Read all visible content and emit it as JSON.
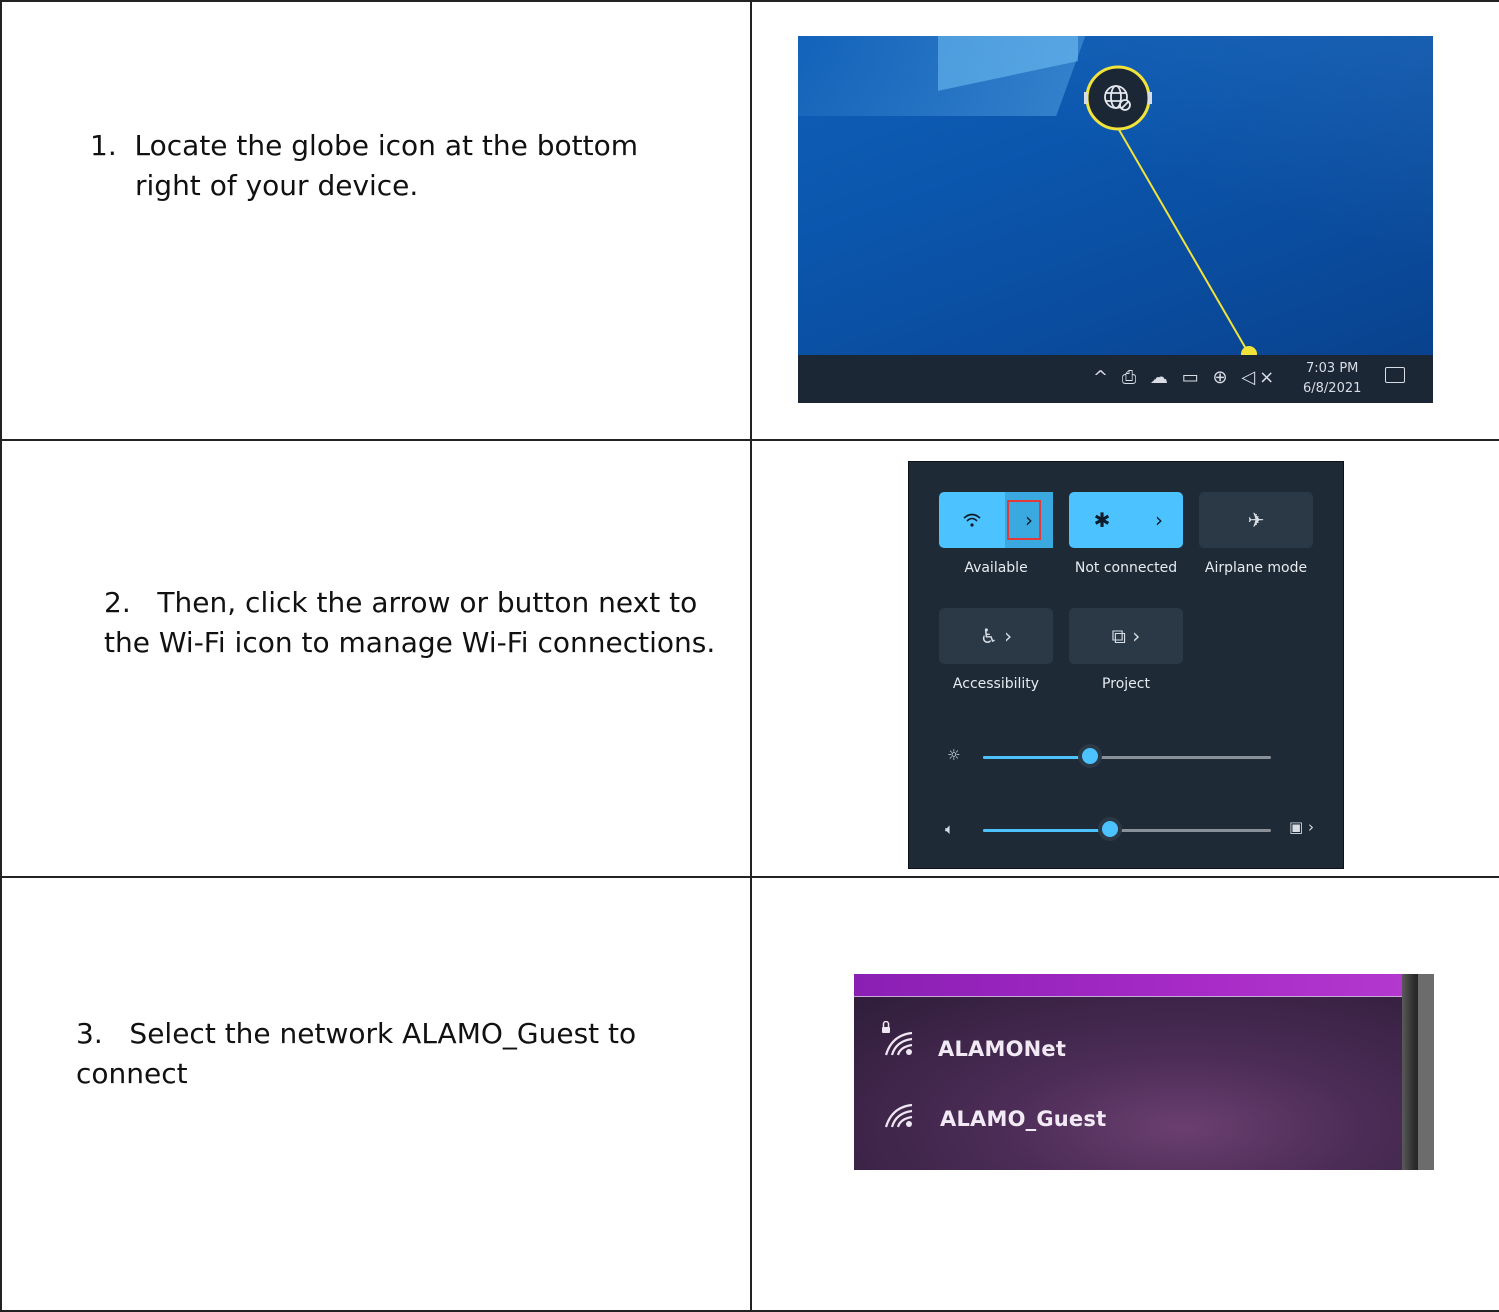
{
  "steps": [
    {
      "number": "1.",
      "text": "Locate the globe icon at the bottom right of your device.",
      "text_line1": "Locate the globe icon at the bottom",
      "text_line2": "right of your device."
    },
    {
      "number": "2.",
      "text_line1": "Then, click the arrow or button next to",
      "text_line2": "the Wi-Fi icon to manage Wi-Fi connections."
    },
    {
      "number": "3.",
      "text_line1": "Select the network ALAMO_Guest to",
      "text_line2": "connect"
    }
  ],
  "taskbar": {
    "time": "7:03 PM",
    "date": "6/8/2021",
    "icons": [
      "chevron-up-icon",
      "meet-now-icon",
      "onedrive-icon",
      "battery-icon",
      "globe-icon",
      "volume-muted-icon",
      "notification-icon"
    ]
  },
  "quick_settings": {
    "tiles": [
      {
        "label": "Available",
        "icon": "wifi-icon",
        "state": "on"
      },
      {
        "label": "Not connected",
        "icon": "bluetooth-icon",
        "state": "on"
      },
      {
        "label": "Airplane mode",
        "icon": "airplane-icon",
        "state": "off"
      },
      {
        "label": "Accessibility",
        "icon": "accessibility-icon",
        "state": "off"
      },
      {
        "label": "Project",
        "icon": "project-icon",
        "state": "off"
      }
    ],
    "brightness_level": 0.37,
    "volume_level": 0.44,
    "accent_color": "#4cc2ff",
    "highlight_color": "#e23a3a"
  },
  "networks": [
    {
      "name": "ALAMONet",
      "secured": true
    },
    {
      "name": "ALAMO_Guest",
      "secured": false
    }
  ]
}
